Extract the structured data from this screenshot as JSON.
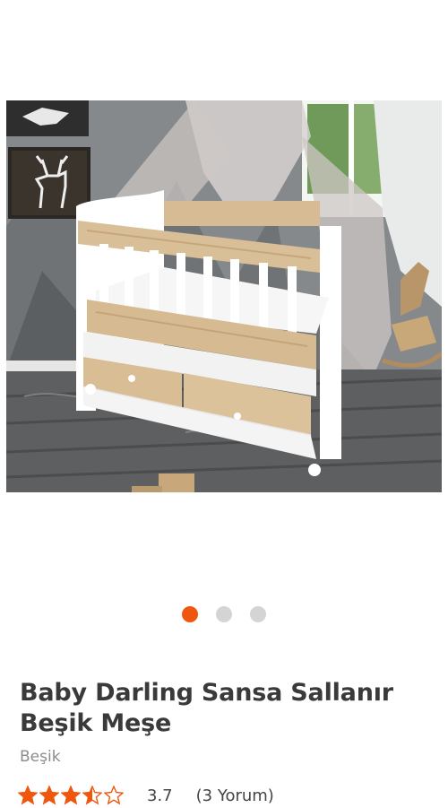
{
  "product": {
    "title": "Baby Darling Sansa Sallanır Beşik Meşe",
    "category": "Beşik",
    "rating": {
      "value": "3.7",
      "reviews": "(3 Yorum)",
      "stars": 3.5,
      "max_stars": 5,
      "star_color": "#f0560e"
    },
    "image_alt": "Beşik"
  },
  "gallery": {
    "active_index": 1,
    "total": 3,
    "active_color": "#f0560e",
    "inactive_color": "#d4d4d4"
  }
}
